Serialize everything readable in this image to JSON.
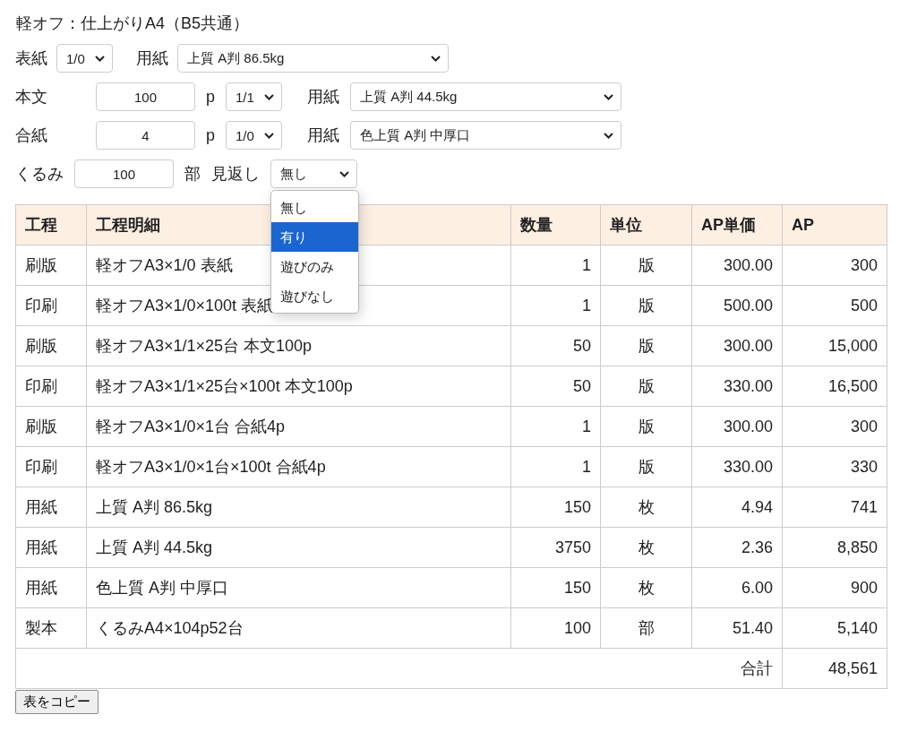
{
  "title": "軽オフ：仕上がりA4（B5共通）",
  "form_rows": [
    {
      "items": [
        {
          "kind": "label",
          "text": "表紙"
        },
        {
          "kind": "select",
          "value": "1/0"
        },
        {
          "kind": "label",
          "text": "用紙"
        },
        {
          "kind": "select",
          "value": "上質 A判 86.5kg"
        }
      ]
    },
    {
      "items": [
        {
          "kind": "label",
          "text": "本文"
        },
        {
          "kind": "input",
          "value": "100"
        },
        {
          "kind": "label",
          "text": "p"
        },
        {
          "kind": "select",
          "value": "1/1"
        },
        {
          "kind": "label",
          "text": "用紙"
        },
        {
          "kind": "select",
          "value": "上質 A判 44.5kg"
        }
      ]
    },
    {
      "items": [
        {
          "kind": "label",
          "text": "合紙"
        },
        {
          "kind": "input",
          "value": "4"
        },
        {
          "kind": "label",
          "text": "p"
        },
        {
          "kind": "select",
          "value": "1/0"
        },
        {
          "kind": "label",
          "text": "用紙"
        },
        {
          "kind": "select",
          "value": "色上質 A判 中厚口"
        }
      ]
    },
    {
      "items": [
        {
          "kind": "label",
          "text": "くるみ"
        },
        {
          "kind": "input",
          "value": "100"
        },
        {
          "kind": "label",
          "text": "部"
        },
        {
          "kind": "label",
          "text": "見返し"
        },
        {
          "kind": "select",
          "value": "無し",
          "expanded": true
        }
      ]
    }
  ],
  "dropdown_options": [
    {
      "label": "無し",
      "selected": false
    },
    {
      "label": "有り",
      "selected": true
    },
    {
      "label": "遊びのみ",
      "selected": false
    },
    {
      "label": "遊びなし",
      "selected": false
    }
  ],
  "table": {
    "columns": [
      "工程",
      "工程明細",
      "数量",
      "単位",
      "AP単価",
      "AP"
    ],
    "rows": [
      [
        "刷版",
        "軽オフA3×1/0 表紙",
        "1",
        "版",
        "300.00",
        "300"
      ],
      [
        "印刷",
        "軽オフA3×1/0×100t 表紙",
        "1",
        "版",
        "500.00",
        "500"
      ],
      [
        "刷版",
        "軽オフA3×1/1×25台 本文100p",
        "50",
        "版",
        "300.00",
        "15,000"
      ],
      [
        "印刷",
        "軽オフA3×1/1×25台×100t 本文100p",
        "50",
        "版",
        "330.00",
        "16,500"
      ],
      [
        "刷版",
        "軽オフA3×1/0×1台 合紙4p",
        "1",
        "版",
        "300.00",
        "300"
      ],
      [
        "印刷",
        "軽オフA3×1/0×1台×100t 合紙4p",
        "1",
        "版",
        "330.00",
        "330"
      ],
      [
        "用紙",
        "上質 A判 86.5kg",
        "150",
        "枚",
        "4.94",
        "741"
      ],
      [
        "用紙",
        "上質 A判 44.5kg",
        "3750",
        "枚",
        "2.36",
        "8,850"
      ],
      [
        "用紙",
        "色上質 A判 中厚口",
        "150",
        "枚",
        "6.00",
        "900"
      ],
      [
        "製本",
        "くるみA4×104p52台",
        "100",
        "部",
        "51.40",
        "5,140"
      ]
    ],
    "total": {
      "label": "合計",
      "value": "48,561"
    }
  },
  "copy_button": "表をコピー"
}
